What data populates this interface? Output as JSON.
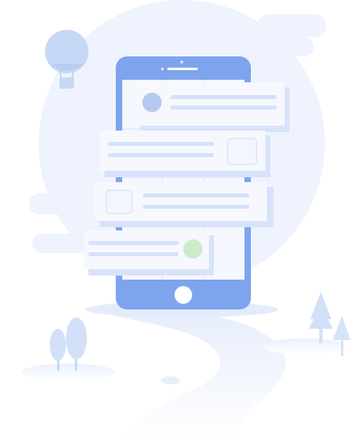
{
  "illustration": {
    "kind": "empty-state illustration",
    "depicts": [
      "smartphone",
      "floating-list-cards",
      "hot-air-balloon",
      "clouds",
      "trees",
      "winding-road"
    ],
    "colors": {
      "background": "#ffffff",
      "backdrop_circle": "#eef3fd",
      "phone_body": "#7ea4ee",
      "phone_screen": "#f4f7fe",
      "card": "#f6f8fe",
      "card_shadow": "#d8e3fa",
      "line": "#d6e2fa",
      "avatar_blue": "#b6c9ef",
      "avatar_green": "#cdebc9",
      "balloon": "#c6d8f6",
      "tree": "#d2e0f8",
      "road": "#eef3fd"
    },
    "list_cards": [
      {
        "leading": "avatar",
        "accent": "blue"
      },
      {
        "leading": "lines",
        "trailing": "checkbox"
      },
      {
        "leading": "checkbox"
      },
      {
        "leading": "lines",
        "trailing": "avatar",
        "accent": "green"
      }
    ]
  }
}
